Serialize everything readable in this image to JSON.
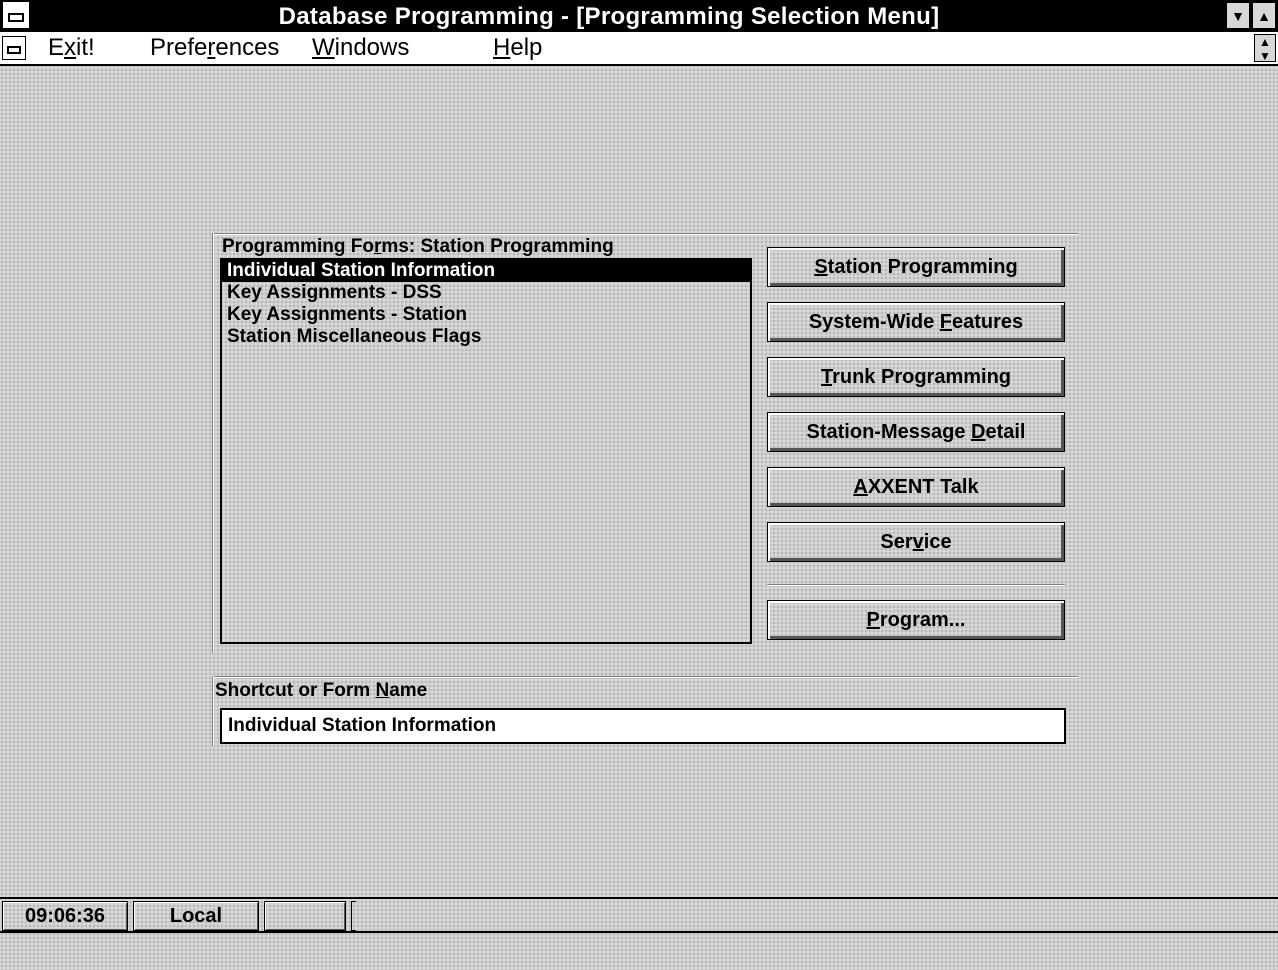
{
  "window": {
    "title": "Database Programming - [Programming Selection Menu]"
  },
  "menu": {
    "exit": {
      "pre": "E",
      "key": "x",
      "post": "it!"
    },
    "preferences": {
      "pre": "Prefe",
      "key": "r",
      "post": "ences"
    },
    "windows": {
      "pre": "",
      "key": "W",
      "post": "indows"
    },
    "help": {
      "pre": "",
      "key": "H",
      "post": "elp"
    }
  },
  "forms": {
    "label_pre": "Programming Fo",
    "label_key": "r",
    "label_post": "ms: Station Programming",
    "items": [
      "Individual Station Information",
      "Key Assignments - DSS",
      "Key Assignments - Station",
      "Station Miscellaneous Flags"
    ],
    "selected_index": 0
  },
  "buttons": {
    "station_programming": {
      "pre": "",
      "key": "S",
      "post": "tation Programming"
    },
    "system_wide_features": {
      "pre": "System-Wide ",
      "key": "F",
      "post": "eatures"
    },
    "trunk_programming": {
      "pre": "",
      "key": "T",
      "post": "runk Programming"
    },
    "station_message_detail": {
      "pre": "Station-Message ",
      "key": "D",
      "post": "etail"
    },
    "axxent_talk": {
      "pre": "",
      "key": "A",
      "post": "XXENT Talk"
    },
    "service": {
      "pre": "Ser",
      "key": "v",
      "post": "ice"
    },
    "program": {
      "pre": "",
      "key": "P",
      "post": "rogram..."
    }
  },
  "shortcut": {
    "label_pre": "Shortcut or Form ",
    "label_key": "N",
    "label_post": "ame",
    "value": "Individual Station Information"
  },
  "status": {
    "time": "09:06:36",
    "mode": "Local",
    "cell3": ""
  }
}
